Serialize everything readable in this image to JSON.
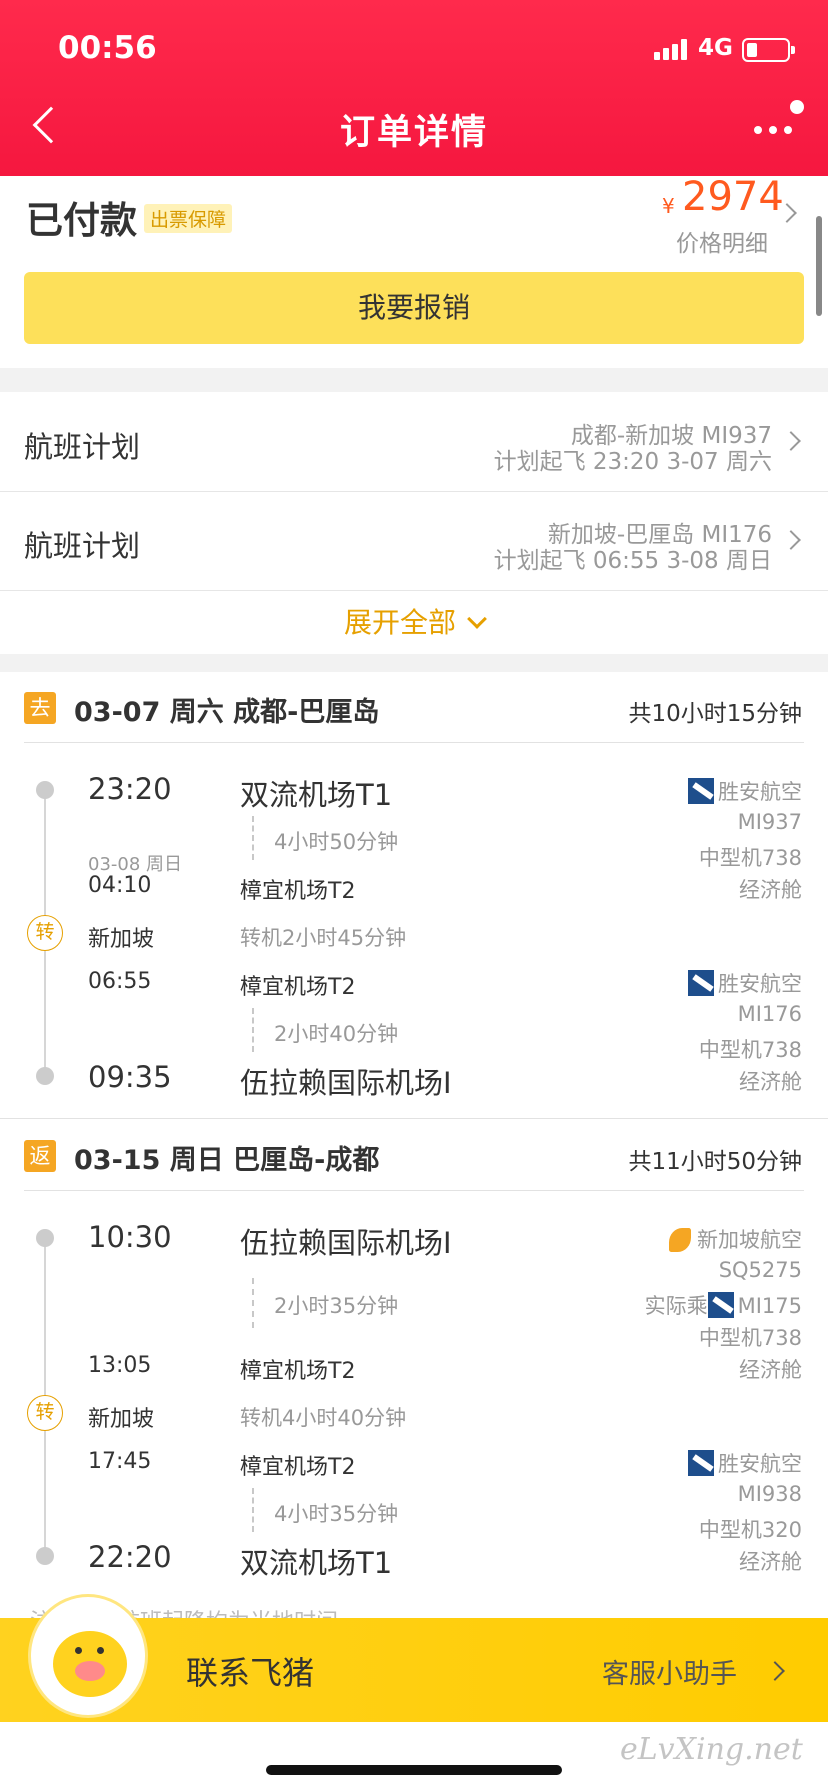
{
  "status_bar": {
    "time": "00:56",
    "network": "4G"
  },
  "nav": {
    "title": "订单详情"
  },
  "order": {
    "status": "已付款",
    "badge": "出票保障",
    "currency": "¥",
    "price": "2974",
    "price_detail": "价格明细",
    "reimburse_button": "我要报销"
  },
  "flight_plans": [
    {
      "label": "航班计划",
      "route": "成都-新加坡 MI937",
      "schedule": "计划起飞 23:20 3-07 周六"
    },
    {
      "label": "航班计划",
      "route": "新加坡-巴厘岛 MI176",
      "schedule": "计划起飞 06:55 3-08 周日"
    }
  ],
  "expand_label": "展开全部",
  "outbound": {
    "tag": "去",
    "title": "03-07 周六 成都-巴厘岛",
    "duration": "共10小时15分钟",
    "seg1": {
      "dep_time": "23:20",
      "dep_airport": "双流机场T1",
      "flight_duration": "4小时50分钟",
      "arr_date": "03-08 周日",
      "arr_time": "04:10",
      "arr_airport": "樟宜机场T2",
      "airline": "胜安航空",
      "flight_no": "MI937",
      "aircraft": "中型机738",
      "cabin": "经济舱"
    },
    "transfer": {
      "icon": "转",
      "city": "新加坡",
      "note": "转机2小时45分钟"
    },
    "seg2": {
      "dep_time": "06:55",
      "dep_airport": "樟宜机场T2",
      "flight_duration": "2小时40分钟",
      "arr_time": "09:35",
      "arr_airport": "伍拉赖国际机场I",
      "airline": "胜安航空",
      "flight_no": "MI176",
      "aircraft": "中型机738",
      "cabin": "经济舱"
    }
  },
  "return": {
    "tag": "返",
    "title": "03-15 周日 巴厘岛-成都",
    "duration": "共11小时50分钟",
    "seg1": {
      "dep_time": "10:30",
      "dep_airport": "伍拉赖国际机场I",
      "flight_duration": "2小时35分钟",
      "arr_time": "13:05",
      "arr_airport": "樟宜机场T2",
      "airline": "新加坡航空",
      "flight_no": "SQ5275",
      "actual_label": "实际乘",
      "actual_flight": "MI175",
      "aircraft": "中型机738",
      "cabin": "经济舱"
    },
    "transfer": {
      "icon": "转",
      "city": "新加坡",
      "note": "转机4小时40分钟"
    },
    "seg2": {
      "dep_time": "17:45",
      "dep_airport": "樟宜机场T2",
      "flight_duration": "4小时35分钟",
      "arr_time": "22:20",
      "arr_airport": "双流机场T1",
      "airline": "胜安航空",
      "flight_no": "MI938",
      "aircraft": "中型机320",
      "cabin": "经济舱"
    }
  },
  "footnote": "注：以上航班起降均为当地时间",
  "footer": {
    "contact": "联系飞猪",
    "assistant": "客服小助手"
  },
  "watermark": "eLvXing.net",
  "colors": {
    "header": "#f5173f",
    "accent": "#e6a000",
    "price": "#ff5a1f",
    "button": "#fde05a",
    "footer": "#ffd21f"
  }
}
